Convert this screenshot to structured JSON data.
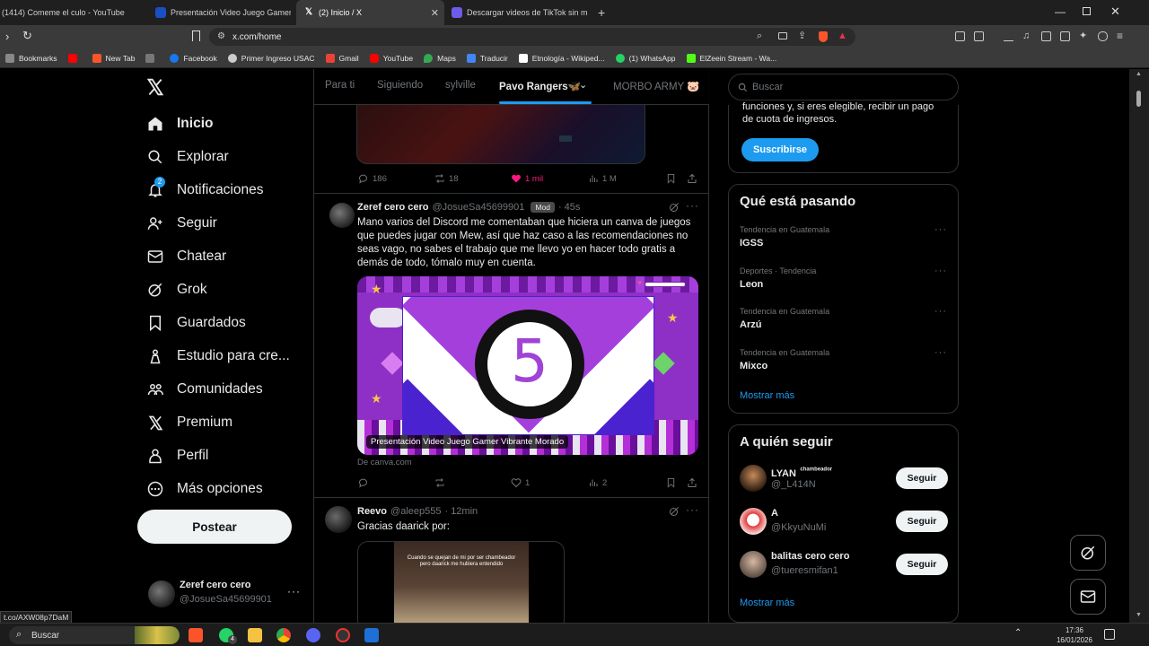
{
  "browser": {
    "tabs": [
      {
        "title": "(1414) Comeme el culo - YouTube",
        "color": "#ff0000"
      },
      {
        "title": "Presentación Video Juego Gamer Vib",
        "color": "#7d2ae8"
      },
      {
        "title": "(2) Inicio / X",
        "color": "#ffffff",
        "active": true
      },
      {
        "title": "Descargar videos de TikTok sin marca",
        "color": "#6c5ce7"
      }
    ],
    "url": "x.com/home",
    "bookmarks": [
      {
        "label": "Bookmarks",
        "color": "#888888"
      },
      {
        "label": "New Tab",
        "color": "#fb542b"
      },
      {
        "label": "",
        "color": "#777777"
      },
      {
        "label": "Facebook",
        "color": "#1877f2"
      },
      {
        "label": "Primer Ingreso USAC",
        "color": "#cccccc"
      },
      {
        "label": "Gmail",
        "color": "#ea4335"
      },
      {
        "label": "YouTube",
        "color": "#ff0000"
      },
      {
        "label": "Maps",
        "color": "#34a853"
      },
      {
        "label": "Traducir",
        "color": "#4285f4"
      },
      {
        "label": "Etnología - Wikiped...",
        "color": "#ffffff"
      },
      {
        "label": "(1) WhatsApp",
        "color": "#25d366"
      },
      {
        "label": "ElZeein Stream - Wa...",
        "color": "#53fc18"
      }
    ],
    "status_url": "t.co/AXW08p7DaM"
  },
  "nav": {
    "items": [
      {
        "label": "Inicio",
        "icon": "home-icon"
      },
      {
        "label": "Explorar",
        "icon": "search-icon"
      },
      {
        "label": "Notificaciones",
        "icon": "bell-icon",
        "badge": "2"
      },
      {
        "label": "Seguir",
        "icon": "follow-icon"
      },
      {
        "label": "Chatear",
        "icon": "mail-icon"
      },
      {
        "label": "Grok",
        "icon": "grok-icon"
      },
      {
        "label": "Guardados",
        "icon": "bookmark-icon"
      },
      {
        "label": "Estudio para cre...",
        "icon": "studio-icon"
      },
      {
        "label": "Comunidades",
        "icon": "communities-icon"
      },
      {
        "label": "Premium",
        "icon": "x-logo-icon"
      },
      {
        "label": "Perfil",
        "icon": "profile-icon"
      },
      {
        "label": "Más opciones",
        "icon": "more-icon"
      }
    ],
    "post_label": "Postear",
    "account": {
      "name": "Zeref cero cero",
      "handle": "@JosueSa45699901"
    }
  },
  "feed": {
    "tabs": [
      "Para ti",
      "Siguiendo",
      "sylville",
      "Pavo Rangers🦋",
      "MORBO ARMY 🐷"
    ],
    "active_tab": "Pavo Rangers🦋",
    "top_stats": {
      "replies": "186",
      "reposts": "18",
      "likes": "1 mil",
      "views": "1 M"
    },
    "tweet1": {
      "name": "Zeref cero cero",
      "handle": "@JosueSa45699901",
      "badge": "Mod",
      "time": "· 45s",
      "text": "Mano varios del Discord me comentaban que hiciera un canva de juegos que puedes jugar con Mew, así que haz caso a las recomendaciones no seas vago, no sabes el trabajo que me llevo yo en hacer todo gratis a demás de todo, tómalo muy en cuenta.",
      "card_title": "Presentación Video Juego Gamer Vibrante Morado",
      "countdown": "5",
      "source": "De canva.com",
      "stats": {
        "replies": "",
        "reposts": "",
        "likes": "1",
        "views": "2"
      }
    },
    "tweet2": {
      "name": "Reevo",
      "handle": "@aleep555",
      "time": "· 12min",
      "text": "Gracias daarick por:",
      "image_caption": "Cuando se quejan de mi por ser chambeador pero daarick me hubiera entendido"
    }
  },
  "sidebar": {
    "search_placeholder": "Buscar",
    "premium": {
      "text1": "funciones y, si eres elegible, recibir un pago",
      "text2": "de cuota de ingresos.",
      "button": "Suscribirse"
    },
    "trends_title": "Qué está pasando",
    "trends": [
      {
        "meta": "Tendencia en Guatemala",
        "name": "IGSS"
      },
      {
        "meta": "Deportes · Tendencia",
        "name": "Leon"
      },
      {
        "meta": "Tendencia en Guatemala",
        "name": "Arzú"
      },
      {
        "meta": "Tendencia en Guatemala",
        "name": "Mixco"
      }
    ],
    "trends_more": "Mostrar más",
    "follow_title": "A quién seguir",
    "suggestions": [
      {
        "name": "LYAN",
        "tag": "chambeador",
        "handle": "@_L414N",
        "button": "Seguir"
      },
      {
        "name": "A",
        "tag": "",
        "handle": "@KkyuNuMi",
        "button": "Seguir"
      },
      {
        "name": "balitas cero cero",
        "tag": "",
        "handle": "@tueresmifan1",
        "button": "Seguir"
      }
    ],
    "follow_more": "Mostrar más"
  },
  "taskbar": {
    "search": "Buscar",
    "time": "17:36",
    "date": "16/01/2026",
    "whatsapp_badge": "4"
  }
}
